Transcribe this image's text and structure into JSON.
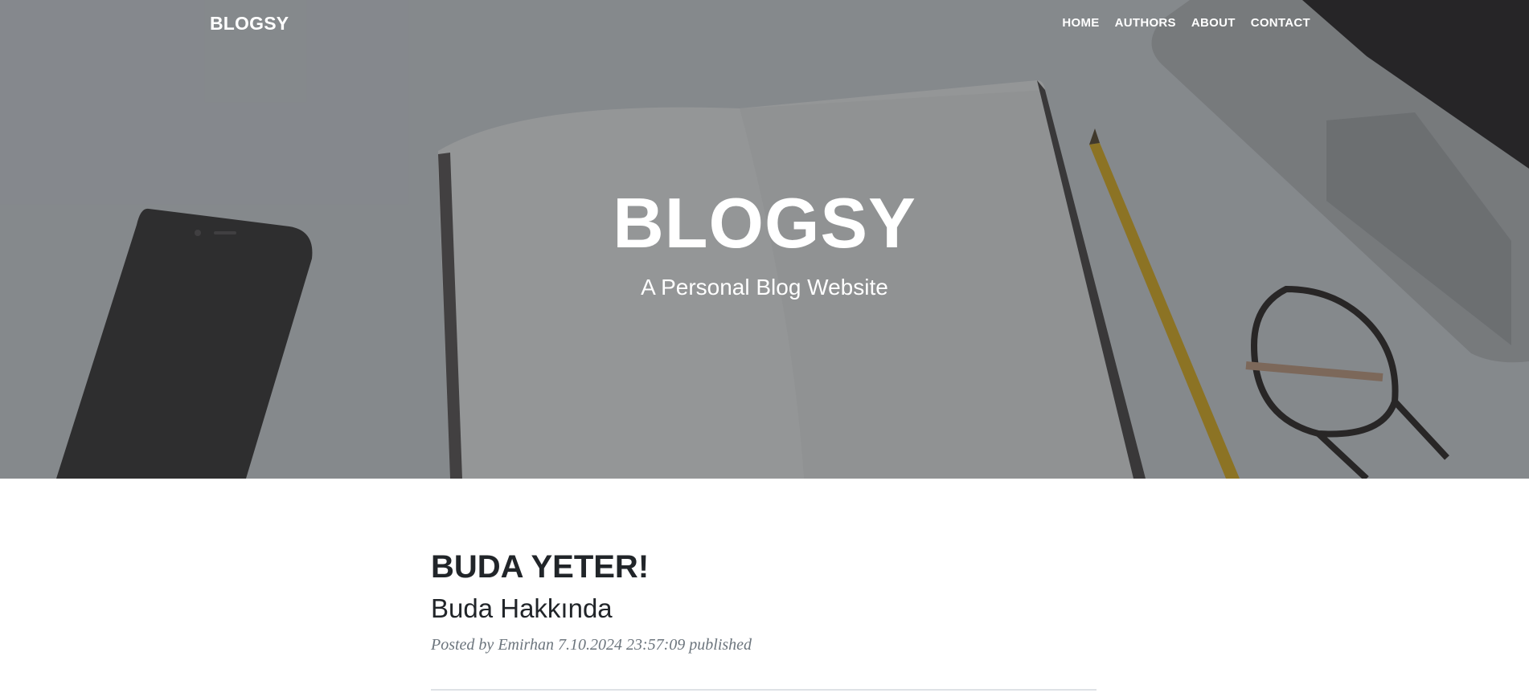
{
  "nav": {
    "brand": "BLOGSY",
    "links": [
      "HOME",
      "AUTHORS",
      "ABOUT",
      "CONTACT"
    ]
  },
  "hero": {
    "heading": "BLOGSY",
    "subheading": "A Personal Blog Website"
  },
  "post": {
    "title": "BUDA YETER!",
    "subtitle": "Buda Hakkında",
    "meta_prefix": "Posted by",
    "author": "Emirhan",
    "meta_suffix": "7.10.2024 23:57:09 published"
  },
  "colors": {
    "text_dark": "#212529",
    "meta_gray": "#6c757d",
    "hero_overlay": "#212529"
  }
}
